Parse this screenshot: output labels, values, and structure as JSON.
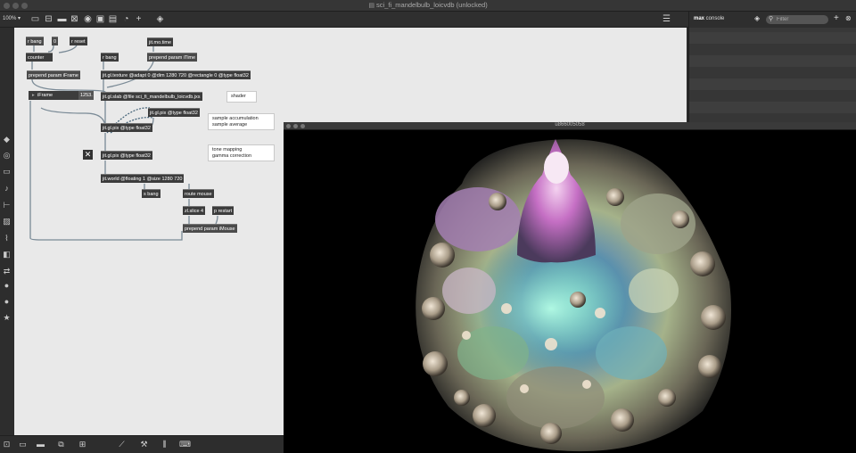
{
  "window": {
    "title": "sci_fi_mandelbulb_loicvdb (unlocked)"
  },
  "toolbar": {
    "zoom": "100% ▾"
  },
  "patch": {
    "objects": {
      "rbang1": "r bang",
      "zero_msg": "0",
      "rreset": "r reset",
      "jitmotime": "jit.mo.time",
      "counter": "counter",
      "rbang2": "r bang",
      "prepend_itime": "prepend param iTime",
      "prepend_iframe": "prepend param iFrame",
      "texture": "jit.gl.texture @adapt 0 @dim 1280 720 @rectangle 0 @type float32",
      "iframe_label": "iFrame",
      "iframe_value": "1253.",
      "slab": "jit.gl.slab @file sci_fi_mandelbulb_loicvdb.jxs",
      "pix1": "jit.gl.pix @type float32",
      "pix2": "jit.gl.pix @type float32",
      "pix3": "jit.gl.pix @type float32",
      "world": "jit.world @floating 1 @size 1280 720",
      "sbang": "s bang",
      "routemouse": "route mouse",
      "zlslice": "zl.slice 4",
      "prestart": "p restart",
      "prepend_imouse": "prepend param iMouse"
    },
    "comments": {
      "shader": "shader",
      "sample1": "sample accumulation",
      "sample2": "sample average",
      "tone1": "tone mapping",
      "tone2": "gamma correction"
    }
  },
  "console": {
    "title_bold": "max",
    "title_rest": " console",
    "filter_placeholder": "Filter"
  },
  "jit_window": {
    "title": "u866005058"
  },
  "colors": {
    "canvas": "#e9e9e9",
    "object": "#3c3c3c",
    "patch_cord": "#7a8a96",
    "signal_cord": "#3e5e74"
  }
}
